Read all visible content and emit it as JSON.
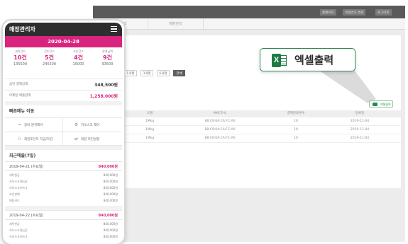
{
  "desktop": {
    "top_buttons": [
      "홈페이지",
      "비밀번호 변경",
      "로그아웃"
    ],
    "tabs": [
      "매출관리",
      "매장관리"
    ],
    "date_ranges": [
      "1개월",
      "3개월",
      "6개월",
      "전체"
    ],
    "excel_button_label": "엑셀출력",
    "table": {
      "headers": [
        "번호",
        "모델",
        "MAC주소",
        "결제완료횟수",
        "등록일"
      ],
      "rows": [
        [
          "",
          "1Mkg",
          "88:C9:0A:CA:FC:A0",
          "10",
          "2019-11-04"
        ],
        [
          "",
          "1Mkg",
          "88:C9:0A:CA:FC:A0",
          "10",
          "2019-11-04"
        ],
        [
          "",
          "1Mkg",
          "88:C9:0A:CA:FC:A0",
          "10",
          "2019-11-04"
        ]
      ]
    }
  },
  "callout": {
    "label": "엑셀출력"
  },
  "app": {
    "title": "매장관리자",
    "date": "2020-04-28",
    "stats": [
      {
        "head": "세탁건수",
        "count": "10건",
        "amount": "135500"
      },
      {
        "head": "건조건수",
        "count": "5건",
        "amount": "245500"
      },
      {
        "head": "코인건수",
        "count": "4건",
        "amount": "15000"
      },
      {
        "head": "합계금액",
        "count": "9건",
        "amount": "93500"
      }
    ],
    "summary": [
      {
        "label": "금번 결제금액",
        "value": "348,500원"
      },
      {
        "label": "어제날 매출합계",
        "value": "1,258,000원"
      }
    ],
    "quick_title": "빠른메뉴 이동",
    "quick_menu": [
      "장비 원격제어",
      "키오스크 제어",
      "회원포인트 지급/차감",
      "회원 마진설정"
    ],
    "recent_title": "최근매출(7일)",
    "days": [
      {
        "date": "2019-04-21 (수요일)",
        "total": "840,000원",
        "items": [
          {
            "name": "세탁현금",
            "value": "840,000원"
          },
          {
            "name": "키오스크(현금)",
            "value": "840,000원"
          },
          {
            "name": "키오스크(카드)",
            "value": "840,000원"
          },
          {
            "name": "코인판매",
            "value": "840,000원"
          },
          {
            "name": "매장카드",
            "value": "840,000원"
          }
        ]
      },
      {
        "date": "2019-04-22 (수요일)",
        "total": "840,000원",
        "items": [
          {
            "name": "세탁현금",
            "value": "840,000원"
          },
          {
            "name": "키오스크(현금)",
            "value": "840,000원"
          },
          {
            "name": "키오스크(카드)",
            "value": "840,000원"
          }
        ]
      }
    ]
  }
}
